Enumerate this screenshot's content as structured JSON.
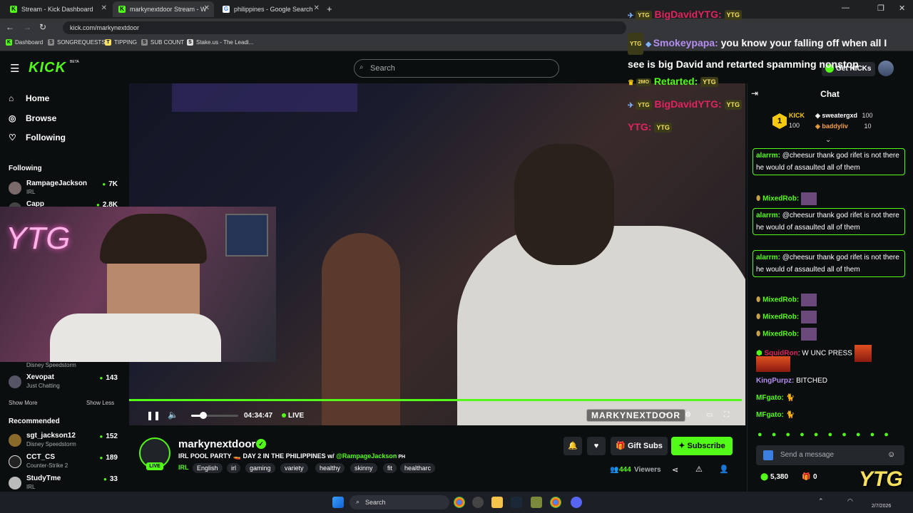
{
  "browser": {
    "tabs": [
      {
        "title": "Stream - Kick Dashboard"
      },
      {
        "title": "markynextdoor Stream - W"
      },
      {
        "title": "philippines - Google Search"
      }
    ],
    "url": "kick.com/markynextdoor",
    "bookmarks": [
      "Dashboard",
      "SONGREQUESTS",
      "TIPPING",
      "SUB COUNT",
      "Stake.us - The Leadi..."
    ]
  },
  "header": {
    "logo": "KICK",
    "beta": "BETA",
    "search_placeholder": "Search",
    "get_kicks": "Get KICKs"
  },
  "sidebar": {
    "nav": [
      {
        "label": "Home",
        "icon": "home-icon"
      },
      {
        "label": "Browse",
        "icon": "compass-icon"
      },
      {
        "label": "Following",
        "icon": "heart-icon"
      }
    ],
    "following_heading": "Following",
    "following": [
      {
        "name": "RampageJackson",
        "category": "IRL",
        "viewers": "7K"
      },
      {
        "name": "Capp",
        "category": "",
        "viewers": "2.8K"
      },
      {
        "name": "",
        "category": "Disney Speedstorm",
        "viewers": ""
      },
      {
        "name": "Xevopat",
        "category": "Just Chatting",
        "viewers": "143"
      }
    ],
    "show_more": "Show More",
    "show_less": "Show Less",
    "recommended_heading": "Recommended",
    "recommended": [
      {
        "name": "sgt_jackson12",
        "category": "Disney Speedstorm",
        "viewers": "152"
      },
      {
        "name": "CCT_CS",
        "category": "Counter-Strike 2",
        "viewers": "189"
      },
      {
        "name": "StudyTme",
        "category": "IRL",
        "viewers": "33"
      }
    ]
  },
  "player": {
    "time": "04:34:47",
    "live": "LIVE",
    "watermark": "MARKYNEXTDOOR",
    "webcam_text": "YTG"
  },
  "stream": {
    "channel": "markynextdoor",
    "title": "IRL POOL PARTY 🚤 DAY 2 IN THE PHILIPPINES w/ ",
    "title_mention": "@RampageJackson",
    "title_suffix": " PH",
    "category": "IRL",
    "tags": [
      "English",
      "irl",
      "gaming",
      "variety",
      "healthy",
      "skinny",
      "fit",
      "healtharc"
    ],
    "live_badge": "LIVE",
    "gift_subs": "Gift Subs",
    "subscribe": "Subscribe",
    "viewers": "444",
    "viewers_label": "Viewers"
  },
  "overlay_chat": [
    {
      "user": "BigDavidYTG:",
      "text": "",
      "emote": "YTG",
      "color": "#e0245e"
    },
    {
      "user": "Smokeypapa:",
      "text": "you know your falling off when all I see is big David and retarted spamming nonstop",
      "emote": "",
      "color": "#b48ef0"
    },
    {
      "user": "Retarted:",
      "text": "",
      "emote": "YTG",
      "color": "#53fc18"
    },
    {
      "user": "BigDavidYTG:",
      "text": "",
      "emote": "YTG",
      "color": "#e0245e"
    },
    {
      "user": "YTG:",
      "text": "",
      "emote": "YTG",
      "color": "#e0245e"
    }
  ],
  "chat": {
    "heading": "Chat",
    "leaderboard": {
      "rank": "1",
      "first": {
        "name": "KICK",
        "amount": "100"
      },
      "entries": [
        {
          "name": "sweatergxd",
          "amount": "100"
        },
        {
          "name": "baddyliv",
          "amount": "10"
        }
      ]
    },
    "messages": [
      {
        "user": "alarrm:",
        "text": "@cheesur thank god rifet is not there he would of assaulted all of them",
        "boxed": true,
        "color": "#53fc18"
      },
      {
        "user": "MixedRob:",
        "text": "",
        "boxed": false,
        "color": "#53fc18"
      },
      {
        "user": "alarrm:",
        "text": "@cheesur thank god rifet is not there he would of assaulted all of them",
        "boxed": true,
        "color": "#53fc18"
      },
      {
        "user": "alarrm:",
        "text": "@cheesur thank god rifet is not there he would of assaulted all of them",
        "boxed": true,
        "color": "#53fc18"
      },
      {
        "user": "MixedRob:",
        "text": "",
        "boxed": false,
        "color": "#53fc18"
      },
      {
        "user": "MixedRob:",
        "text": "",
        "boxed": false,
        "color": "#53fc18"
      },
      {
        "user": "MixedRob:",
        "text": "",
        "boxed": false,
        "color": "#53fc18"
      },
      {
        "user": "SquidRon",
        "text": ": W UNC PRESS",
        "boxed": false,
        "color": "#e0245e"
      },
      {
        "user": "KingPurpz:",
        "text": " BITCHED",
        "boxed": false,
        "color": "#b48ef0"
      },
      {
        "user": "MFgato:",
        "text": "",
        "boxed": false,
        "color": "#53fc18"
      },
      {
        "user": "MFgato:",
        "text": "",
        "boxed": false,
        "color": "#53fc18"
      }
    ],
    "input_placeholder": "Send a message",
    "points": "5,380",
    "gifts": "0"
  },
  "taskbar": {
    "search": "Search",
    "date": "2/7/2026"
  },
  "colors": {
    "accent": "#53fc18",
    "background": "#0b0e0f",
    "surface": "#24272c"
  }
}
